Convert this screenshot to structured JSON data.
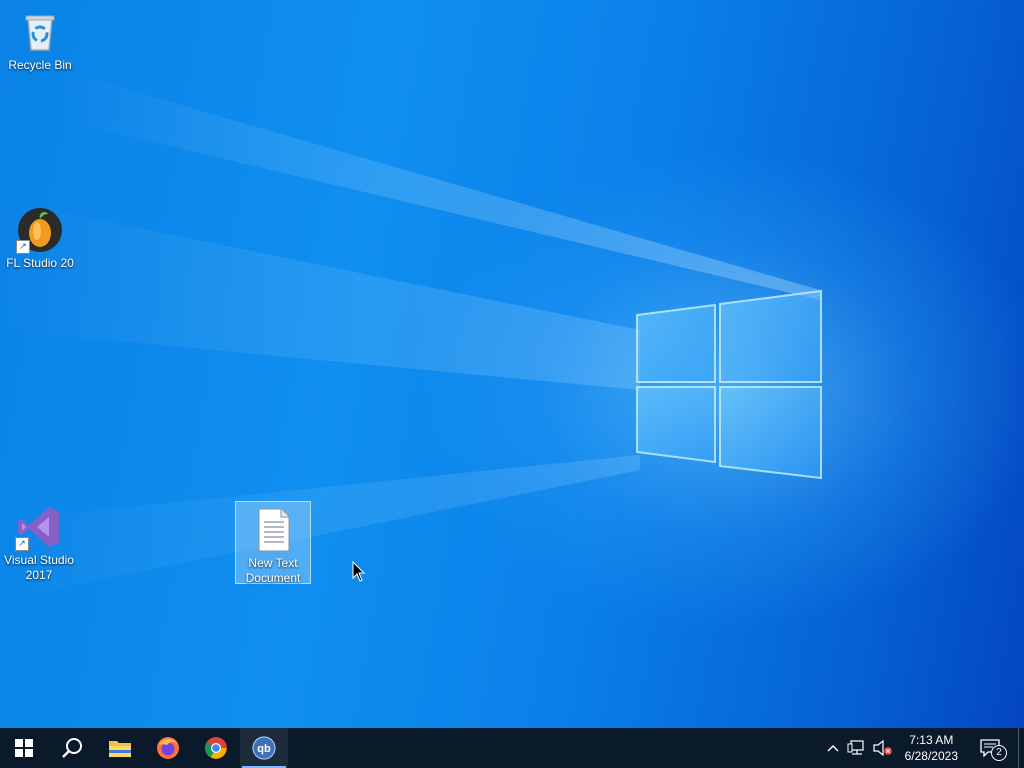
{
  "desktop": {
    "icons": [
      {
        "label": "Recycle Bin",
        "icon": "recycle-bin-icon"
      },
      {
        "label": "FL Studio 20",
        "icon": "fl-studio-icon"
      },
      {
        "label": "Visual Studio 2017",
        "icon": "visual-studio-icon"
      },
      {
        "label": "New Text Document",
        "icon": "text-document-icon"
      }
    ]
  },
  "taskbar": {
    "buttons": [
      {
        "name": "start",
        "icon": "windows-logo-icon"
      },
      {
        "name": "search",
        "icon": "search-icon"
      },
      {
        "name": "file-explorer",
        "icon": "folder-icon"
      },
      {
        "name": "firefox",
        "icon": "firefox-icon"
      },
      {
        "name": "chrome",
        "icon": "chrome-icon"
      },
      {
        "name": "qbittorrent",
        "icon": "qbittorrent-icon",
        "text": "qb"
      }
    ],
    "tray": {
      "time": "7:13 AM",
      "date": "6/28/2023",
      "notification_count": "2"
    }
  },
  "colors": {
    "taskbar": "#0b1a2a",
    "desktop_accent": "#0a82e6"
  }
}
